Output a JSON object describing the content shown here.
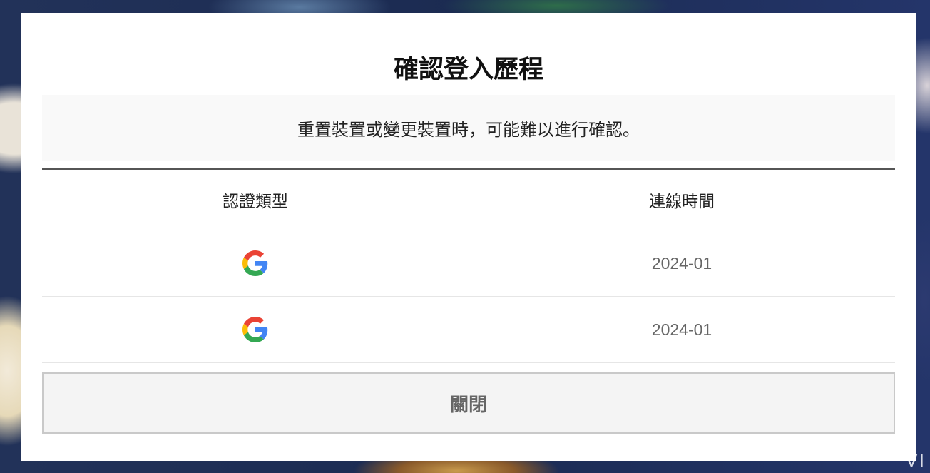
{
  "modal": {
    "title": "確認登入歷程",
    "notice": "重置裝置或變更裝置時，可能難以進行確認。",
    "table": {
      "headers": [
        "認證類型",
        "連線時間"
      ],
      "rows": [
        {
          "auth_icon": "google-icon",
          "time": "2024-01"
        },
        {
          "auth_icon": "google-icon",
          "time": "2024-01"
        }
      ]
    },
    "close_label": "關閉"
  },
  "background": {
    "corner_text": "VI"
  },
  "colors": {
    "google_blue": "#4285F4",
    "google_red": "#EA4335",
    "google_yellow": "#FBBC05",
    "google_green": "#34A853"
  }
}
